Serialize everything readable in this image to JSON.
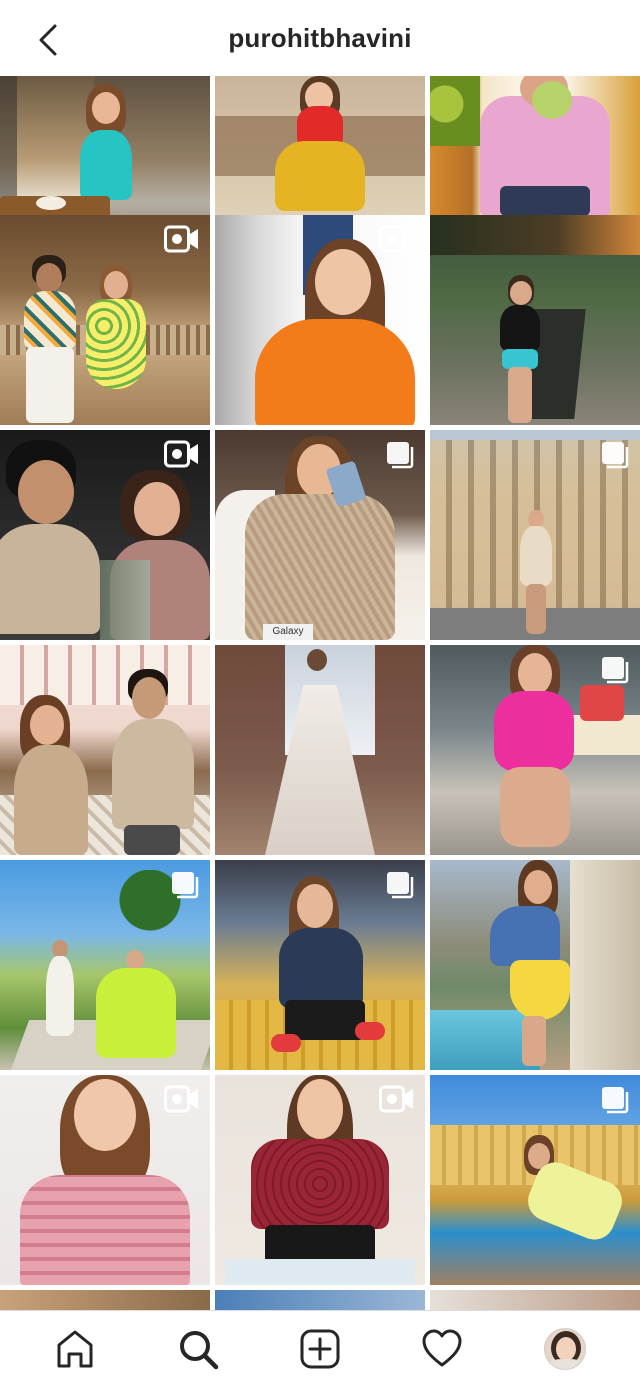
{
  "header": {
    "username": "purohitbhavini",
    "back_icon": "chevron-left-icon"
  },
  "grid": {
    "tiles": [
      {
        "id": 1,
        "badge": null,
        "product_text": ""
      },
      {
        "id": 2,
        "badge": null,
        "product_text": ""
      },
      {
        "id": 3,
        "badge": null,
        "product_text": ""
      },
      {
        "id": 4,
        "badge": "reel-icon",
        "product_text": ""
      },
      {
        "id": 5,
        "badge": "reel-icon",
        "product_text": ""
      },
      {
        "id": 6,
        "badge": null,
        "product_text": ""
      },
      {
        "id": 7,
        "badge": "reel-icon",
        "product_text": ""
      },
      {
        "id": 8,
        "badge": "carousel-icon",
        "product_text": "Galaxy"
      },
      {
        "id": 9,
        "badge": "carousel-icon",
        "product_text": ""
      },
      {
        "id": 10,
        "badge": null,
        "product_text": ""
      },
      {
        "id": 11,
        "badge": null,
        "product_text": ""
      },
      {
        "id": 12,
        "badge": "carousel-icon",
        "product_text": ""
      },
      {
        "id": 13,
        "badge": "carousel-icon",
        "product_text": ""
      },
      {
        "id": 14,
        "badge": "carousel-icon",
        "product_text": ""
      },
      {
        "id": 15,
        "badge": null,
        "product_text": ""
      },
      {
        "id": 16,
        "badge": "reel-icon",
        "product_text": ""
      },
      {
        "id": 17,
        "badge": "reel-icon",
        "product_text": ""
      },
      {
        "id": 18,
        "badge": "carousel-icon",
        "product_text": ""
      }
    ]
  },
  "bottom_nav": {
    "items": [
      {
        "name": "home-icon"
      },
      {
        "name": "search-icon",
        "active": true
      },
      {
        "name": "new-post-icon"
      },
      {
        "name": "activity-heart-icon"
      },
      {
        "name": "profile-avatar"
      }
    ]
  },
  "colors": {
    "text_primary": "#262626",
    "border": "#dbdbdb",
    "background": "#ffffff"
  }
}
